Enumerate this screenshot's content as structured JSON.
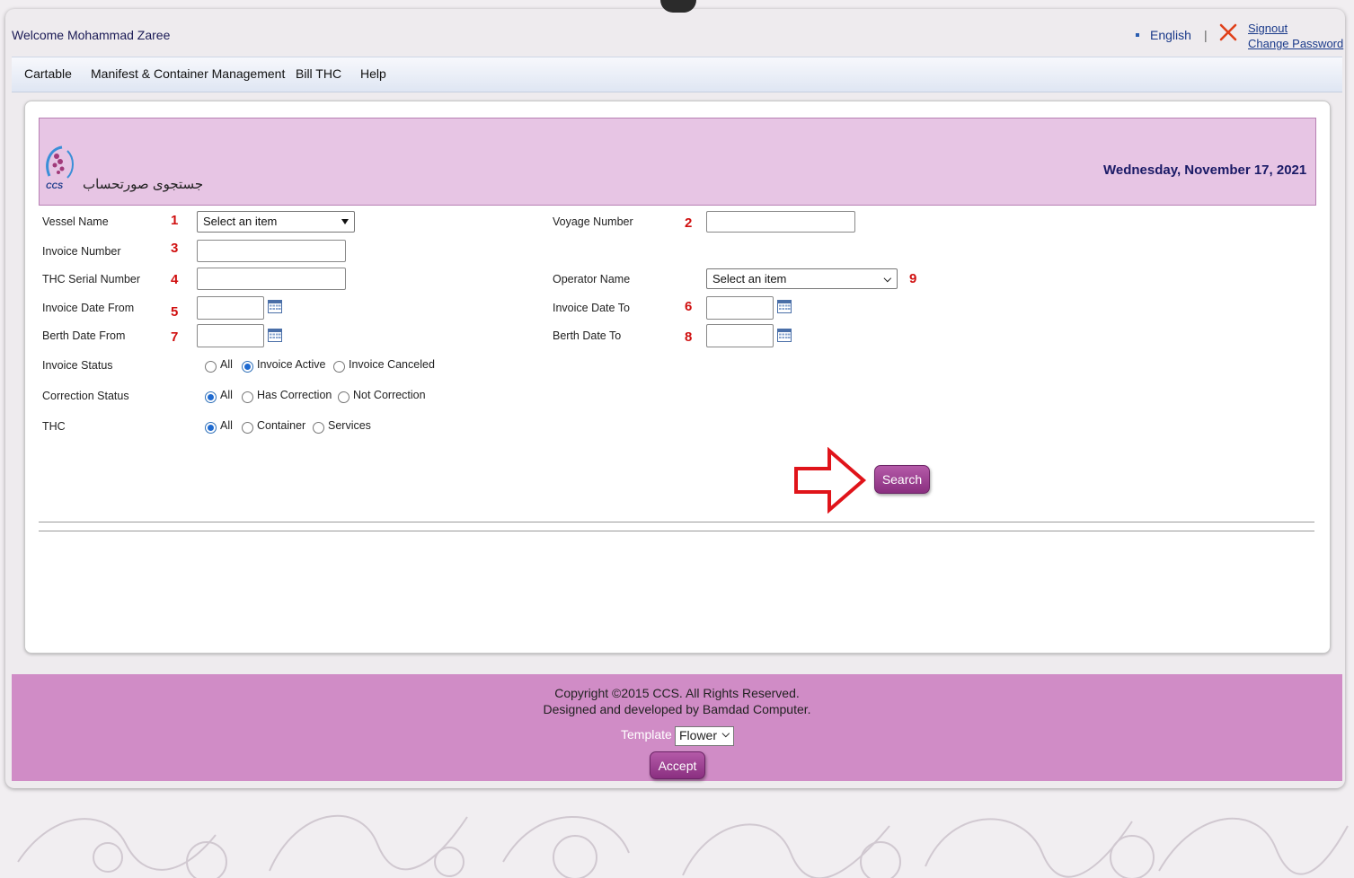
{
  "header": {
    "welcome": "Welcome Mohammad Zaree",
    "language": "English",
    "separator": "|",
    "signout": "Signout",
    "change_password": "Change Password"
  },
  "menu": [
    "Cartable",
    "Manifest & Container Management",
    "Bill THC",
    "Help"
  ],
  "banner": {
    "title": "جستجوی صورتحساب",
    "date": "Wednesday, November 17, 2021",
    "logo_text": "CCS"
  },
  "form": {
    "vessel_name": {
      "label": "Vessel Name",
      "num": "1",
      "selected": "Select an item"
    },
    "voyage_number": {
      "label": "Voyage Number",
      "num": "2",
      "value": ""
    },
    "invoice_number": {
      "label": "Invoice Number",
      "num": "3",
      "value": ""
    },
    "thc_serial_number": {
      "label": "THC Serial Number",
      "num": "4",
      "value": ""
    },
    "operator_name": {
      "label": "Operator Name",
      "num": "9",
      "selected": "Select an item"
    },
    "invoice_date_from": {
      "label": "Invoice Date From",
      "num": "5",
      "value": ""
    },
    "invoice_date_to": {
      "label": "Invoice Date To",
      "num": "6",
      "value": ""
    },
    "berth_date_from": {
      "label": "Berth Date From",
      "num": "7",
      "value": ""
    },
    "berth_date_to": {
      "label": "Berth Date To",
      "num": "8",
      "value": ""
    },
    "invoice_status": {
      "label": "Invoice Status",
      "options": [
        "All",
        "Invoice Active",
        "Invoice Canceled"
      ],
      "selected": "Invoice Active"
    },
    "correction_status": {
      "label": "Correction Status",
      "options": [
        "All",
        "Has Correction",
        "Not Correction"
      ],
      "selected": "All"
    },
    "thc": {
      "label": "THC",
      "options": [
        "All",
        "Container",
        "Services"
      ],
      "selected": "All"
    },
    "search_label": "Search"
  },
  "footer": {
    "copyright": "Copyright ©2015 CCS. All Rights Reserved.",
    "developer": "Designed and developed by Bamdad Computer.",
    "template_label": "Template",
    "template_value": "Flower",
    "accept_label": "Accept"
  },
  "colors": {
    "banner_bg": "#e7c5e4",
    "footer_bg": "#d08cc6",
    "button_purple": "#9b3f91",
    "marker_red": "#d01010",
    "date_navy": "#1a1a66"
  },
  "icons": {
    "close": "close-x-icon",
    "calendar": "calendar-icon",
    "arrow": "red-outline-arrow-icon",
    "logo": "ccs-logo-icon"
  }
}
